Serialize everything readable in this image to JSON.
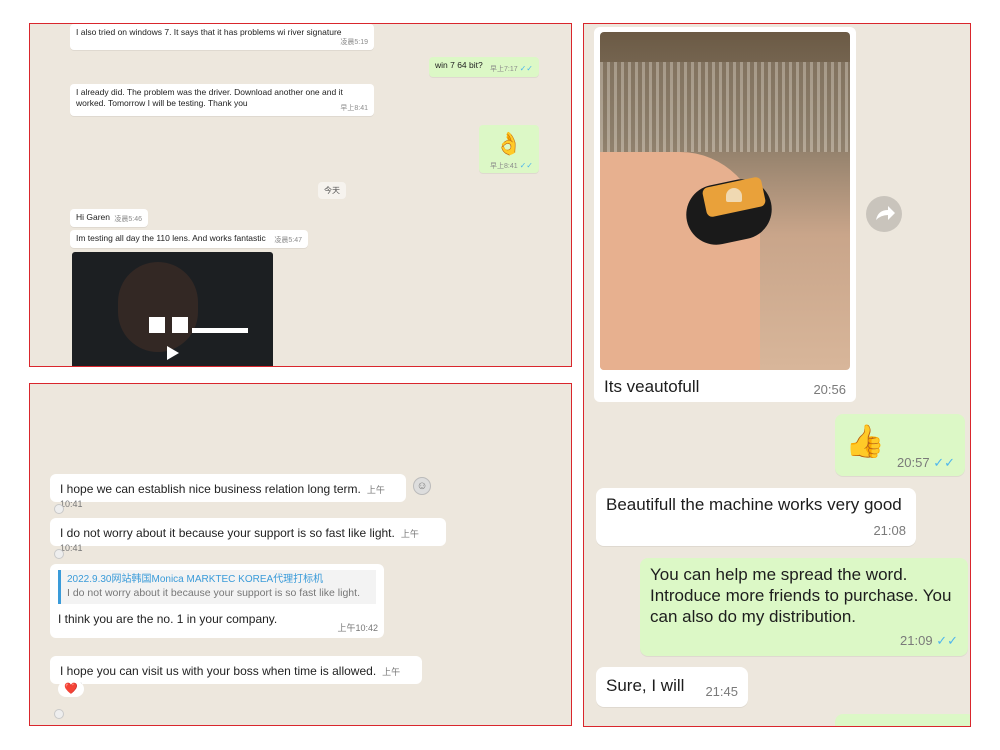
{
  "panel1": {
    "msg1": {
      "text": "I also tried on windows 7. It says that it has problems wi  river signature",
      "time": "凌晨5:19"
    },
    "msg2": {
      "text": "win 7  64 bit?",
      "time": "早上7:17"
    },
    "msg3": {
      "text": "I already did. The problem was the driver. Download another one and it worked. Tomorrow I will be testing. Thank you",
      "time": "早上8:41"
    },
    "msg4": {
      "emoji": "👌",
      "time": "早上8:41"
    },
    "day_label": "今天",
    "msg5": {
      "text": "Hi Garen",
      "time": "凌晨5:46"
    },
    "msg6": {
      "text": "Im testing all day the 110 lens. And works fantastic",
      "time": "凌晨5:47"
    }
  },
  "panel2": {
    "img_caption": "Its veautofull",
    "img_time": "20:56",
    "thumb": {
      "emoji": "👍",
      "time": "20:57"
    },
    "msg1": {
      "text": "Beautifull the machine works very good",
      "time": "21:08"
    },
    "msg2": {
      "text": "You can help me spread the word. Introduce more friends to purchase. You can also do my distribution.",
      "time": "21:09"
    },
    "msg3": {
      "text": "Sure, I will",
      "time": "21:45"
    }
  },
  "panel3": {
    "msg1": {
      "text": "I hope we can establish nice business relation long term.",
      "time": "上午10:41"
    },
    "msg2": {
      "text": "I do not worry about it because your support is so fast like light.",
      "time": "上午10:41"
    },
    "quote": {
      "source": "2022.9.30网站韩国Monica MARKTEC KOREA代理打标机",
      "text": "I do not worry about it because your support is so fast like light."
    },
    "msg3": {
      "text": "I think you are the no. 1 in your company.",
      "time": "上午10:42"
    },
    "msg4": {
      "text": "I hope you can visit us with your boss when time is allowed.",
      "time": "上午10:42"
    },
    "reaction": "❤️"
  },
  "colors": {
    "outgoing": "#dcf8c6",
    "incoming": "#ffffff",
    "tick": "#4fb6ec",
    "quote_title": "#3a9bd9",
    "border": "#d9262c"
  }
}
